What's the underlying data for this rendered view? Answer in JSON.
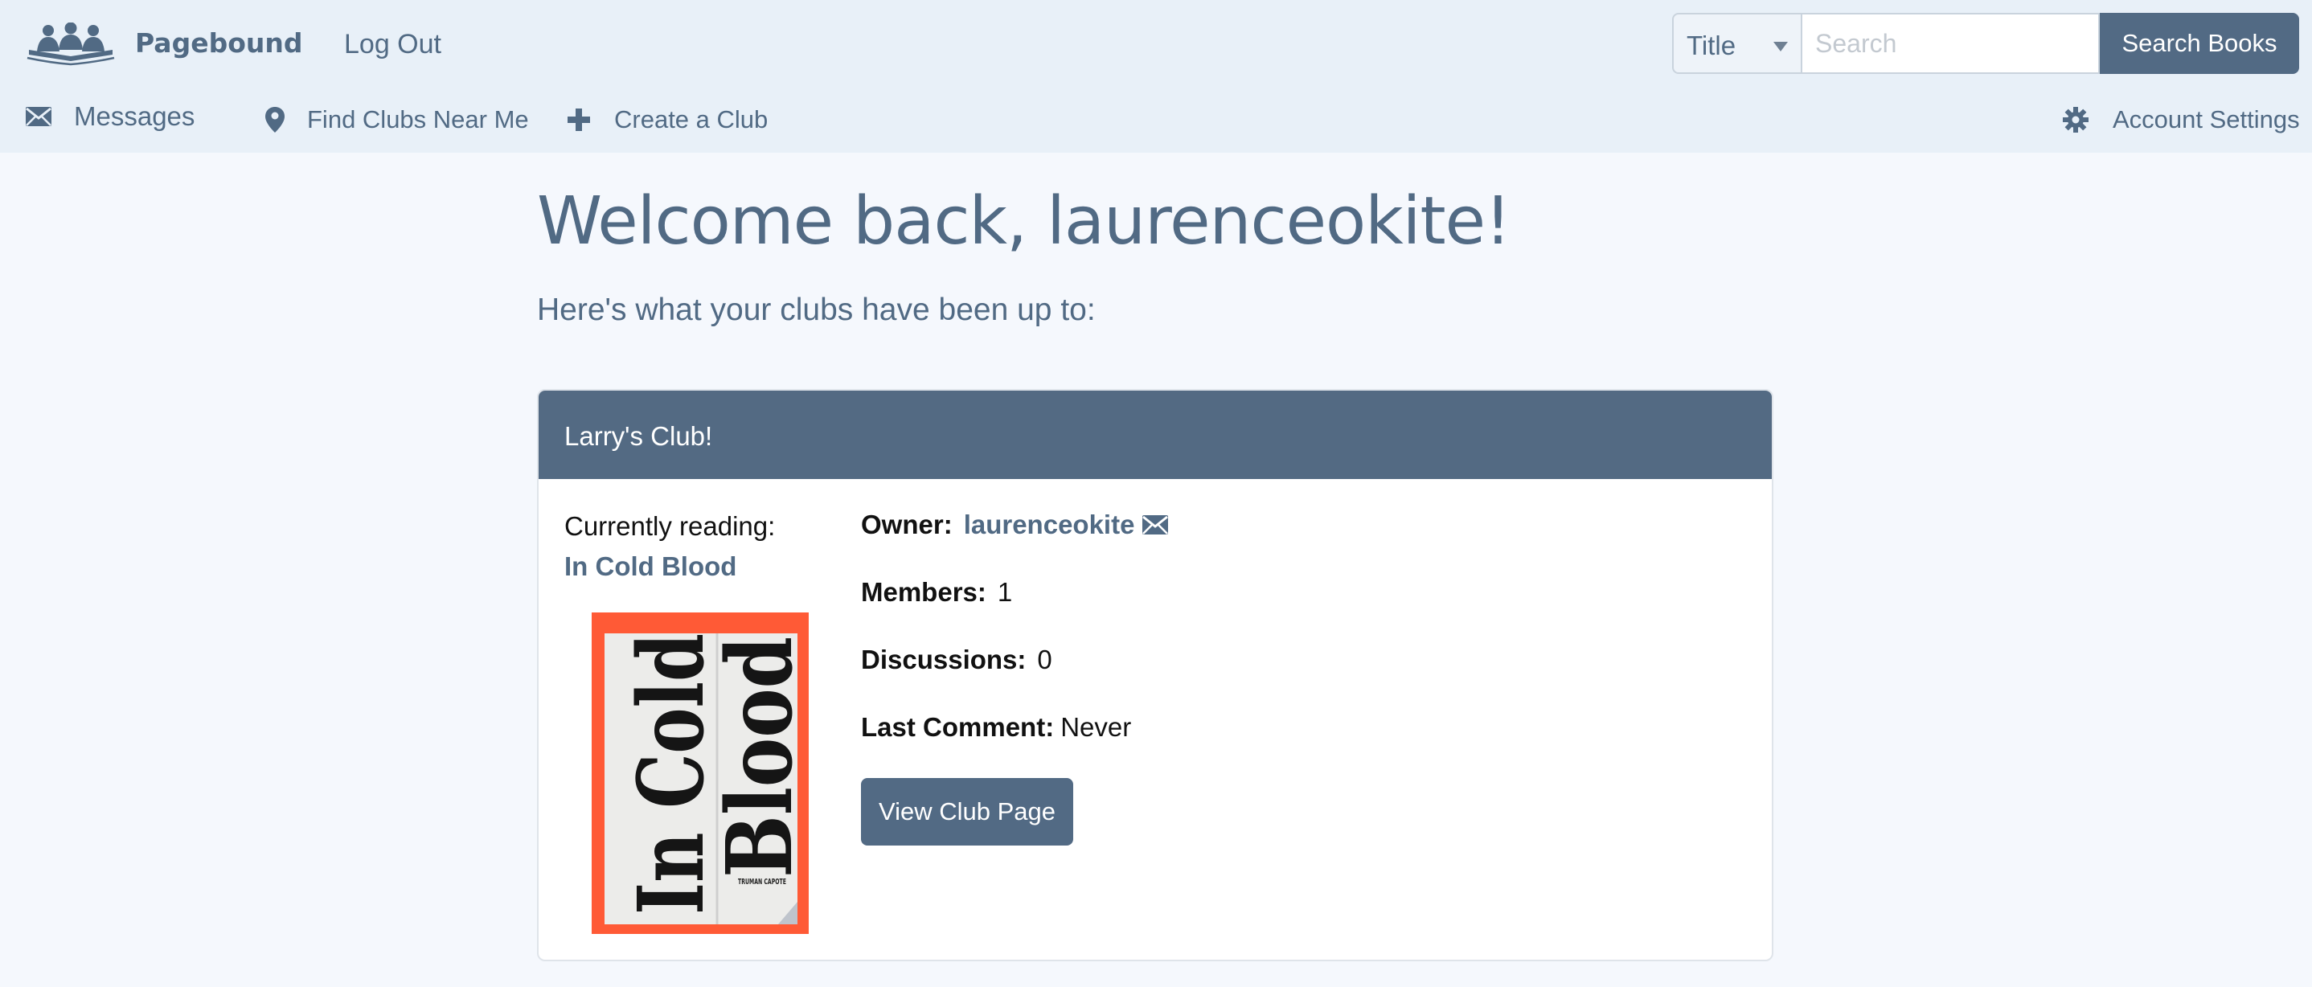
{
  "header": {
    "brand": "Pagebound",
    "logout_label": "Log Out",
    "search": {
      "field_selected": "Title",
      "placeholder": "Search",
      "value": "",
      "button_label": "Search Books"
    }
  },
  "nav": {
    "messages": {
      "label": "Messages",
      "icon": "envelope-icon"
    },
    "find_clubs": {
      "label": "Find Clubs Near Me",
      "icon": "map-pin-icon"
    },
    "create_club": {
      "label": "Create a Club",
      "icon": "plus-icon"
    },
    "account_settings": {
      "label": "Account Settings",
      "icon": "gear-icon"
    }
  },
  "main": {
    "welcome": "Welcome back, laurenceokite!",
    "subhead": "Here's what your clubs have been up to:"
  },
  "club": {
    "name": "Larry's Club!",
    "currently_reading_label": "Currently reading:",
    "book_title": "In Cold Blood",
    "cover": {
      "line1": "In Cold",
      "line2": "Blood",
      "author": "TRUMAN CAPOTE",
      "background_color": "#ff5a36"
    },
    "owner_label": "Owner:",
    "owner_name": "laurenceokite",
    "members_label": "Members:",
    "members_value": "1",
    "discussions_label": "Discussions:",
    "discussions_value": "0",
    "last_comment_label": "Last Comment:",
    "last_comment_value": "Never",
    "view_button_label": "View Club Page"
  },
  "colors": {
    "accent": "#526a84",
    "header_bg": "#e8f0f8",
    "page_bg": "#f5f8fd"
  }
}
